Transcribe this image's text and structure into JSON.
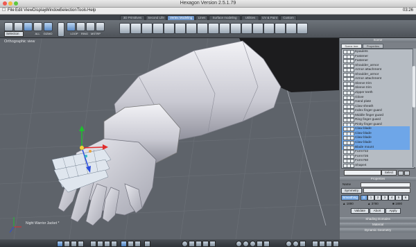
{
  "app": {
    "title": "Hexagon Version 2.5.1.79",
    "clock": "03:26"
  },
  "menu": [
    "File",
    "Edit",
    "View",
    "Display",
    "Window",
    "Selection",
    "Tools",
    "Help"
  ],
  "tabs": [
    {
      "label": "3D Primitives",
      "active": false
    },
    {
      "label": "Second Life",
      "active": false
    },
    {
      "label": "Vertex Modeling",
      "active": true
    },
    {
      "label": "Lines",
      "active": false
    },
    {
      "label": "Surface modeling",
      "active": false
    },
    {
      "label": "Utilities",
      "active": false
    },
    {
      "label": "UV & Paint",
      "active": false
    },
    {
      "label": "Custom",
      "active": false
    }
  ],
  "toolbar": {
    "selection_value": "Selection",
    "labels": [
      "LOOP",
      "RING",
      "MSTRP",
      "GIZMO",
      "ALL"
    ]
  },
  "viewport": {
    "label": "Orthographic view",
    "object_name": "Night Warrior Jacket *"
  },
  "scene": {
    "header": "Scene",
    "tabs": [
      {
        "label": "Scene tree",
        "active": true
      },
      {
        "label": "Properties",
        "active": false
      }
    ],
    "items": [
      {
        "label": "Epaulets",
        "selected": false
      },
      {
        "label": "Fastener",
        "selected": false
      },
      {
        "label": "Fastener",
        "selected": false
      },
      {
        "label": "Shoulder_armor",
        "selected": false
      },
      {
        "label": "Armor attachment",
        "selected": false
      },
      {
        "label": "Shoulder_armor",
        "selected": false
      },
      {
        "label": "Armor attachment",
        "selected": false
      },
      {
        "label": "Sleeve trim",
        "selected": false
      },
      {
        "label": "Sleeve trim",
        "selected": false
      },
      {
        "label": "Zipper teeth",
        "selected": false
      },
      {
        "label": "Glove",
        "selected": false
      },
      {
        "label": "Hand plate",
        "selected": false
      },
      {
        "label": "Claw sheath",
        "selected": false
      },
      {
        "label": "Index finger guard",
        "selected": false
      },
      {
        "label": "Middle finger guard",
        "selected": false
      },
      {
        "label": "Ring finger guard",
        "selected": false
      },
      {
        "label": "Pinky finger guard",
        "selected": false
      },
      {
        "label": "Claw blade",
        "selected": true
      },
      {
        "label": "Claw blade",
        "selected": true
      },
      {
        "label": "Claw blade",
        "selected": true
      },
      {
        "label": "Claw blade",
        "selected": true
      },
      {
        "label": "Blade mount",
        "selected": true
      },
      {
        "label": "Form722",
        "selected": false
      },
      {
        "label": "Form726",
        "selected": false
      },
      {
        "label": "Form760",
        "selected": false
      },
      {
        "label": "Shape4",
        "selected": false
      }
    ],
    "select_button": "Select"
  },
  "properties": {
    "header": "Properties",
    "name_label": "Name",
    "symmetry_label": "Symmetry",
    "smoothing_label": "Smoothing",
    "smoothing_levels": [
      "0",
      "1",
      "2",
      "3",
      "4",
      "5",
      "6"
    ],
    "smoothing_selected": "0",
    "stat_a": "1890",
    "stat_b": "3780",
    "stat_c": "1890",
    "validate": "Validate",
    "abort": "Abort",
    "apply": "Apply"
  },
  "panels": [
    "Shading Domains",
    "Material",
    "Dynamic Geometry"
  ]
}
